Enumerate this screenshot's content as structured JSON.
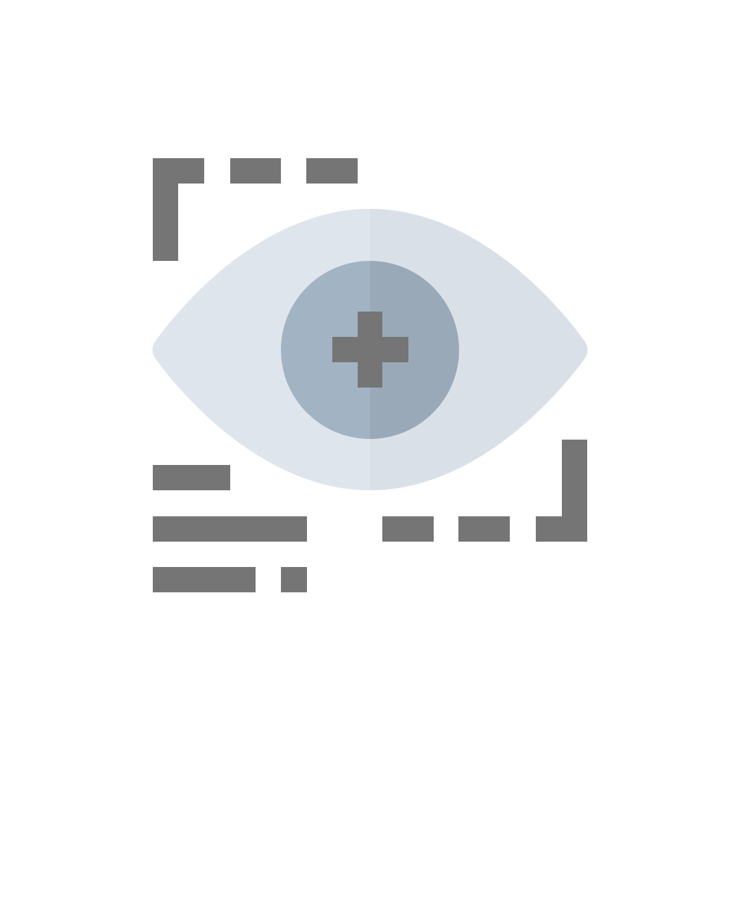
{
  "illustration": {
    "icon": "eye-scan-plus-icon",
    "colors": {
      "background": "#ffffff",
      "frame": "#757575",
      "eye_white_left": "#dfe5ed",
      "eye_white_right": "#d9e0e8",
      "iris_left": "#a2b3c4",
      "iris_right": "#99a9b7",
      "plus": "#757575",
      "text_lines": "#757575"
    }
  }
}
